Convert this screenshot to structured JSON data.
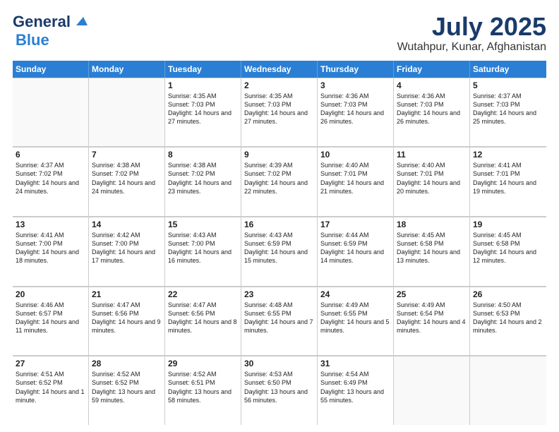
{
  "header": {
    "logo_line1": "General",
    "logo_line2": "Blue",
    "title": "July 2025",
    "subtitle": "Wutahpur, Kunar, Afghanistan"
  },
  "calendar": {
    "days_of_week": [
      "Sunday",
      "Monday",
      "Tuesday",
      "Wednesday",
      "Thursday",
      "Friday",
      "Saturday"
    ],
    "weeks": [
      [
        {
          "day": "",
          "sunrise": "",
          "sunset": "",
          "daylight": ""
        },
        {
          "day": "",
          "sunrise": "",
          "sunset": "",
          "daylight": ""
        },
        {
          "day": "1",
          "sunrise": "Sunrise: 4:35 AM",
          "sunset": "Sunset: 7:03 PM",
          "daylight": "Daylight: 14 hours and 27 minutes."
        },
        {
          "day": "2",
          "sunrise": "Sunrise: 4:35 AM",
          "sunset": "Sunset: 7:03 PM",
          "daylight": "Daylight: 14 hours and 27 minutes."
        },
        {
          "day": "3",
          "sunrise": "Sunrise: 4:36 AM",
          "sunset": "Sunset: 7:03 PM",
          "daylight": "Daylight: 14 hours and 26 minutes."
        },
        {
          "day": "4",
          "sunrise": "Sunrise: 4:36 AM",
          "sunset": "Sunset: 7:03 PM",
          "daylight": "Daylight: 14 hours and 26 minutes."
        },
        {
          "day": "5",
          "sunrise": "Sunrise: 4:37 AM",
          "sunset": "Sunset: 7:03 PM",
          "daylight": "Daylight: 14 hours and 25 minutes."
        }
      ],
      [
        {
          "day": "6",
          "sunrise": "Sunrise: 4:37 AM",
          "sunset": "Sunset: 7:02 PM",
          "daylight": "Daylight: 14 hours and 24 minutes."
        },
        {
          "day": "7",
          "sunrise": "Sunrise: 4:38 AM",
          "sunset": "Sunset: 7:02 PM",
          "daylight": "Daylight: 14 hours and 24 minutes."
        },
        {
          "day": "8",
          "sunrise": "Sunrise: 4:38 AM",
          "sunset": "Sunset: 7:02 PM",
          "daylight": "Daylight: 14 hours and 23 minutes."
        },
        {
          "day": "9",
          "sunrise": "Sunrise: 4:39 AM",
          "sunset": "Sunset: 7:02 PM",
          "daylight": "Daylight: 14 hours and 22 minutes."
        },
        {
          "day": "10",
          "sunrise": "Sunrise: 4:40 AM",
          "sunset": "Sunset: 7:01 PM",
          "daylight": "Daylight: 14 hours and 21 minutes."
        },
        {
          "day": "11",
          "sunrise": "Sunrise: 4:40 AM",
          "sunset": "Sunset: 7:01 PM",
          "daylight": "Daylight: 14 hours and 20 minutes."
        },
        {
          "day": "12",
          "sunrise": "Sunrise: 4:41 AM",
          "sunset": "Sunset: 7:01 PM",
          "daylight": "Daylight: 14 hours and 19 minutes."
        }
      ],
      [
        {
          "day": "13",
          "sunrise": "Sunrise: 4:41 AM",
          "sunset": "Sunset: 7:00 PM",
          "daylight": "Daylight: 14 hours and 18 minutes."
        },
        {
          "day": "14",
          "sunrise": "Sunrise: 4:42 AM",
          "sunset": "Sunset: 7:00 PM",
          "daylight": "Daylight: 14 hours and 17 minutes."
        },
        {
          "day": "15",
          "sunrise": "Sunrise: 4:43 AM",
          "sunset": "Sunset: 7:00 PM",
          "daylight": "Daylight: 14 hours and 16 minutes."
        },
        {
          "day": "16",
          "sunrise": "Sunrise: 4:43 AM",
          "sunset": "Sunset: 6:59 PM",
          "daylight": "Daylight: 14 hours and 15 minutes."
        },
        {
          "day": "17",
          "sunrise": "Sunrise: 4:44 AM",
          "sunset": "Sunset: 6:59 PM",
          "daylight": "Daylight: 14 hours and 14 minutes."
        },
        {
          "day": "18",
          "sunrise": "Sunrise: 4:45 AM",
          "sunset": "Sunset: 6:58 PM",
          "daylight": "Daylight: 14 hours and 13 minutes."
        },
        {
          "day": "19",
          "sunrise": "Sunrise: 4:45 AM",
          "sunset": "Sunset: 6:58 PM",
          "daylight": "Daylight: 14 hours and 12 minutes."
        }
      ],
      [
        {
          "day": "20",
          "sunrise": "Sunrise: 4:46 AM",
          "sunset": "Sunset: 6:57 PM",
          "daylight": "Daylight: 14 hours and 11 minutes."
        },
        {
          "day": "21",
          "sunrise": "Sunrise: 4:47 AM",
          "sunset": "Sunset: 6:56 PM",
          "daylight": "Daylight: 14 hours and 9 minutes."
        },
        {
          "day": "22",
          "sunrise": "Sunrise: 4:47 AM",
          "sunset": "Sunset: 6:56 PM",
          "daylight": "Daylight: 14 hours and 8 minutes."
        },
        {
          "day": "23",
          "sunrise": "Sunrise: 4:48 AM",
          "sunset": "Sunset: 6:55 PM",
          "daylight": "Daylight: 14 hours and 7 minutes."
        },
        {
          "day": "24",
          "sunrise": "Sunrise: 4:49 AM",
          "sunset": "Sunset: 6:55 PM",
          "daylight": "Daylight: 14 hours and 5 minutes."
        },
        {
          "day": "25",
          "sunrise": "Sunrise: 4:49 AM",
          "sunset": "Sunset: 6:54 PM",
          "daylight": "Daylight: 14 hours and 4 minutes."
        },
        {
          "day": "26",
          "sunrise": "Sunrise: 4:50 AM",
          "sunset": "Sunset: 6:53 PM",
          "daylight": "Daylight: 14 hours and 2 minutes."
        }
      ],
      [
        {
          "day": "27",
          "sunrise": "Sunrise: 4:51 AM",
          "sunset": "Sunset: 6:52 PM",
          "daylight": "Daylight: 14 hours and 1 minute."
        },
        {
          "day": "28",
          "sunrise": "Sunrise: 4:52 AM",
          "sunset": "Sunset: 6:52 PM",
          "daylight": "Daylight: 13 hours and 59 minutes."
        },
        {
          "day": "29",
          "sunrise": "Sunrise: 4:52 AM",
          "sunset": "Sunset: 6:51 PM",
          "daylight": "Daylight: 13 hours and 58 minutes."
        },
        {
          "day": "30",
          "sunrise": "Sunrise: 4:53 AM",
          "sunset": "Sunset: 6:50 PM",
          "daylight": "Daylight: 13 hours and 56 minutes."
        },
        {
          "day": "31",
          "sunrise": "Sunrise: 4:54 AM",
          "sunset": "Sunset: 6:49 PM",
          "daylight": "Daylight: 13 hours and 55 minutes."
        },
        {
          "day": "",
          "sunrise": "",
          "sunset": "",
          "daylight": ""
        },
        {
          "day": "",
          "sunrise": "",
          "sunset": "",
          "daylight": ""
        }
      ]
    ]
  }
}
